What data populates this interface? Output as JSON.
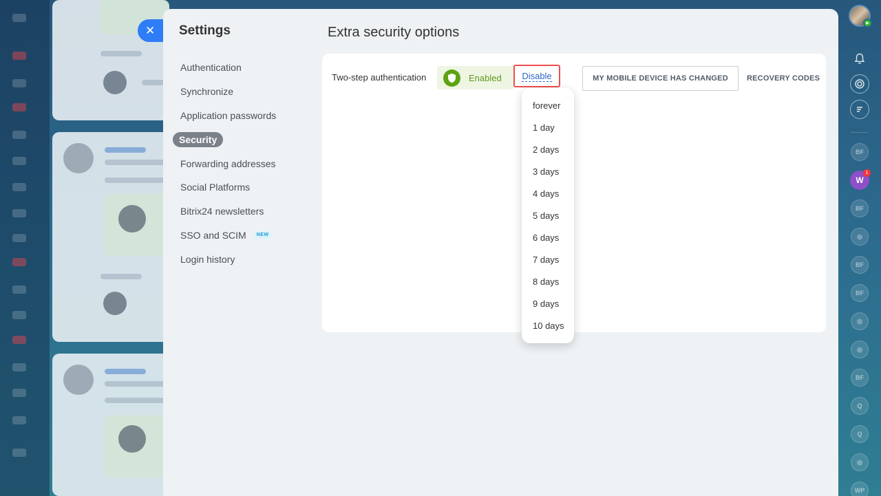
{
  "settings": {
    "title": "Settings",
    "nav": [
      {
        "label": "Authentication"
      },
      {
        "label": "Synchronize"
      },
      {
        "label": "Application passwords"
      },
      {
        "label": "Security",
        "active": true
      },
      {
        "label": "Forwarding addresses"
      },
      {
        "label": "Social Platforms"
      },
      {
        "label": "Bitrix24 newsletters"
      },
      {
        "label": "SSO and SCIM",
        "badge": "NEW"
      },
      {
        "label": "Login history"
      }
    ]
  },
  "security": {
    "title": "Extra security options",
    "two_step_label": "Two-step authentication",
    "status": "Enabled",
    "disable_label": "Disable",
    "mobile_button": "MY MOBILE DEVICE HAS CHANGED",
    "recovery_button": "RECOVERY CODES",
    "disable_options": [
      "forever",
      "1 day",
      "2 days",
      "3 days",
      "4 days",
      "5 days",
      "6 days",
      "7 days",
      "8 days",
      "9 days",
      "10 days"
    ]
  },
  "messenger": {
    "notification_count": "1",
    "chats": [
      {
        "initials": "BF"
      },
      {
        "initials": "W",
        "unread": "1"
      },
      {
        "initials": "BF"
      },
      {
        "initials": "",
        "icon": "channel-icon"
      },
      {
        "initials": "BF"
      },
      {
        "initials": "BF"
      },
      {
        "initials": "",
        "icon": "channel-icon"
      },
      {
        "initials": "",
        "icon": "channel-icon"
      },
      {
        "initials": "BF"
      },
      {
        "initials": "Q"
      },
      {
        "initials": "Q"
      },
      {
        "initials": "",
        "icon": "channel-icon"
      },
      {
        "initials": "WP"
      }
    ]
  },
  "colors": {
    "accent_blue": "#2f7df6",
    "enabled_green": "#5da312",
    "highlight_red": "#ef4e4e"
  }
}
